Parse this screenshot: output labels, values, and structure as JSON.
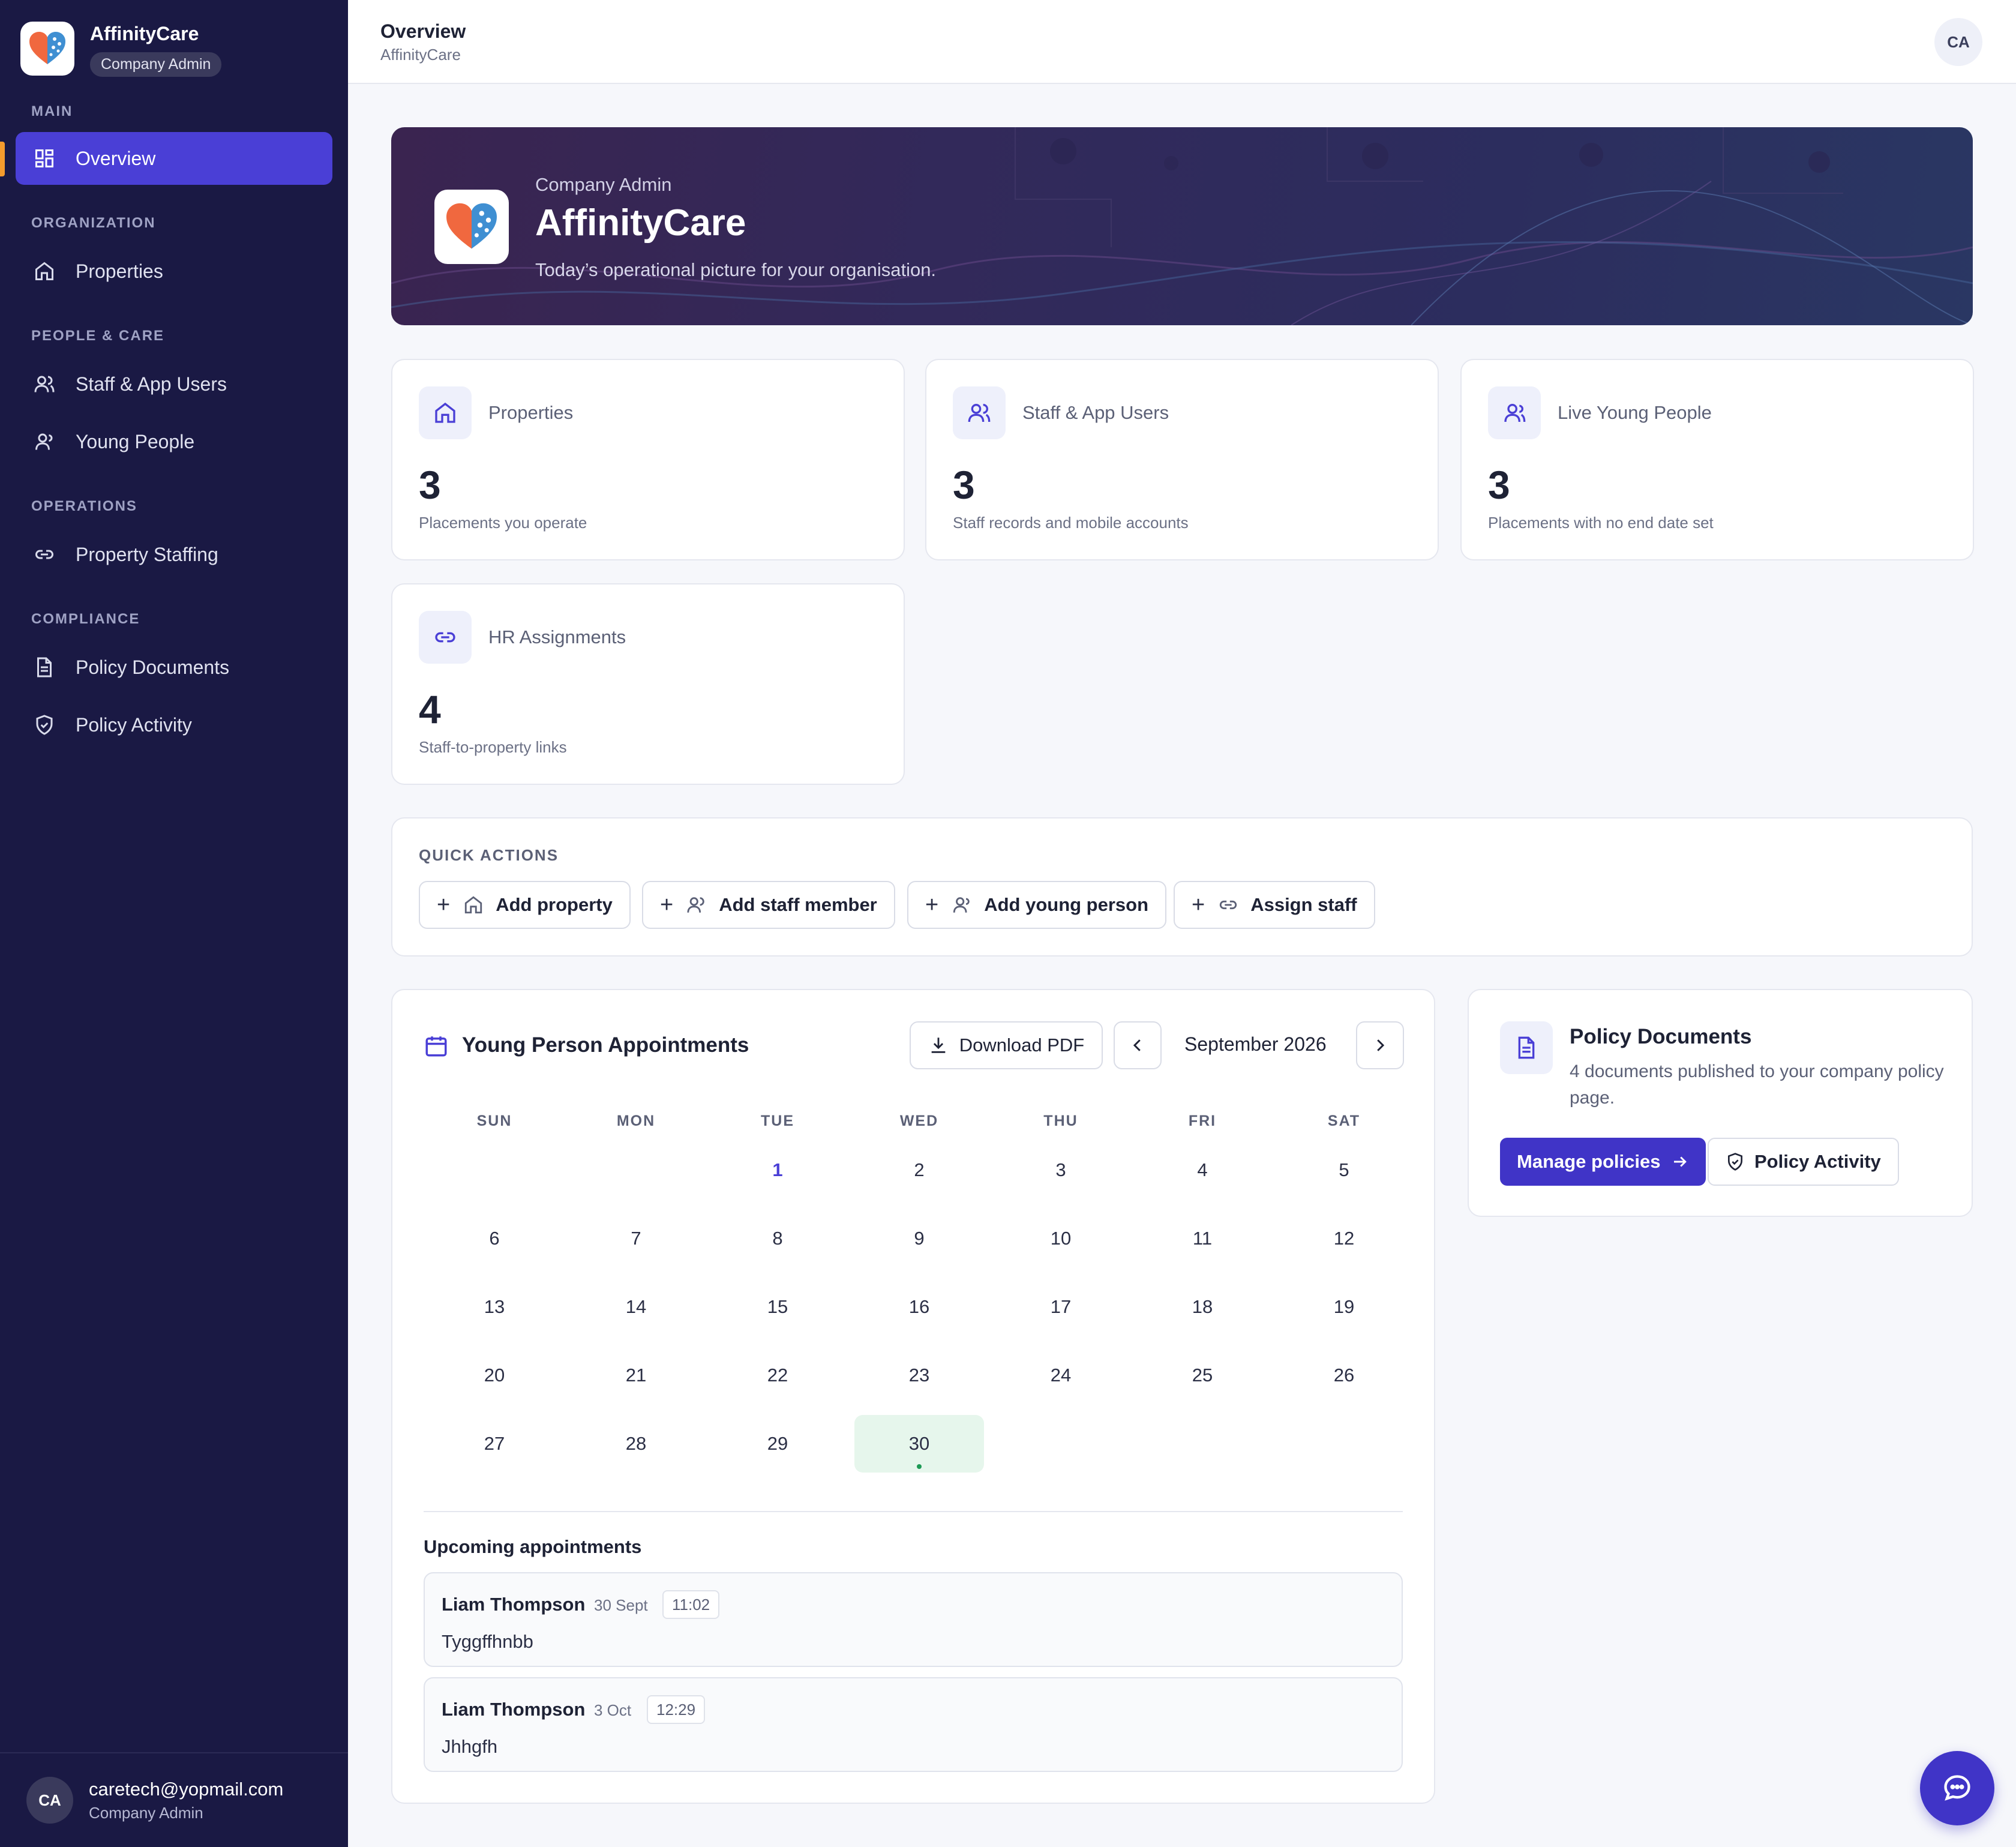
{
  "brand": {
    "name": "AffinityCare",
    "role": "Company Admin"
  },
  "sidebar": {
    "sections": {
      "main": "MAIN",
      "organization": "ORGANIZATION",
      "people_care": "PEOPLE & CARE",
      "operations": "OPERATIONS",
      "compliance": "COMPLIANCE"
    },
    "items": {
      "overview": "Overview",
      "properties": "Properties",
      "staff": "Staff & App Users",
      "young_people": "Young People",
      "property_staffing": "Property Staffing",
      "policy_documents": "Policy Documents",
      "policy_activity": "Policy Activity"
    },
    "footer": {
      "initials": "CA",
      "email": "caretech@yopmail.com",
      "role": "Company Admin"
    }
  },
  "header": {
    "title": "Overview",
    "subtitle": "AffinityCare",
    "avatar": "CA"
  },
  "hero": {
    "eyebrow": "Company Admin",
    "title": "AffinityCare",
    "subtitle": "Today’s operational picture for your organisation."
  },
  "stats": [
    {
      "label": "Properties",
      "value": "3",
      "caption": "Placements you operate"
    },
    {
      "label": "Staff & App Users",
      "value": "3",
      "caption": "Staff records and mobile accounts"
    },
    {
      "label": "Live Young People",
      "value": "3",
      "caption": "Placements with no end date set"
    },
    {
      "label": "HR Assignments",
      "value": "4",
      "caption": "Staff-to-property links"
    }
  ],
  "quick_actions": {
    "title": "QUICK ACTIONS",
    "buttons": [
      "Add property",
      "Add staff member",
      "Add young person",
      "Assign staff"
    ]
  },
  "calendar": {
    "title": "Young Person Appointments",
    "download": "Download PDF",
    "month": "September 2026",
    "weekdays": [
      "SUN",
      "MON",
      "TUE",
      "WED",
      "THU",
      "FRI",
      "SAT"
    ],
    "first_weekday": 2,
    "days_in_month": 30,
    "highlight_day": 1,
    "today_day": 30,
    "upcoming_title": "Upcoming appointments",
    "appointments": [
      {
        "name": "Liam Thompson",
        "date": "30 Sept",
        "time": "11:02",
        "note": "Tyggffhnbb"
      },
      {
        "name": "Liam Thompson",
        "date": "3 Oct",
        "time": "12:29",
        "note": "Jhhgfh"
      }
    ]
  },
  "policy": {
    "title": "Policy Documents",
    "description": "4 documents published to your company policy page.",
    "manage": "Manage policies",
    "activity": "Policy Activity"
  },
  "colors": {
    "accent": "#4a3fd6",
    "sidebar_bg": "#1a1944",
    "active_marker": "#f59b2d",
    "today_bg": "#e6f6ec"
  }
}
